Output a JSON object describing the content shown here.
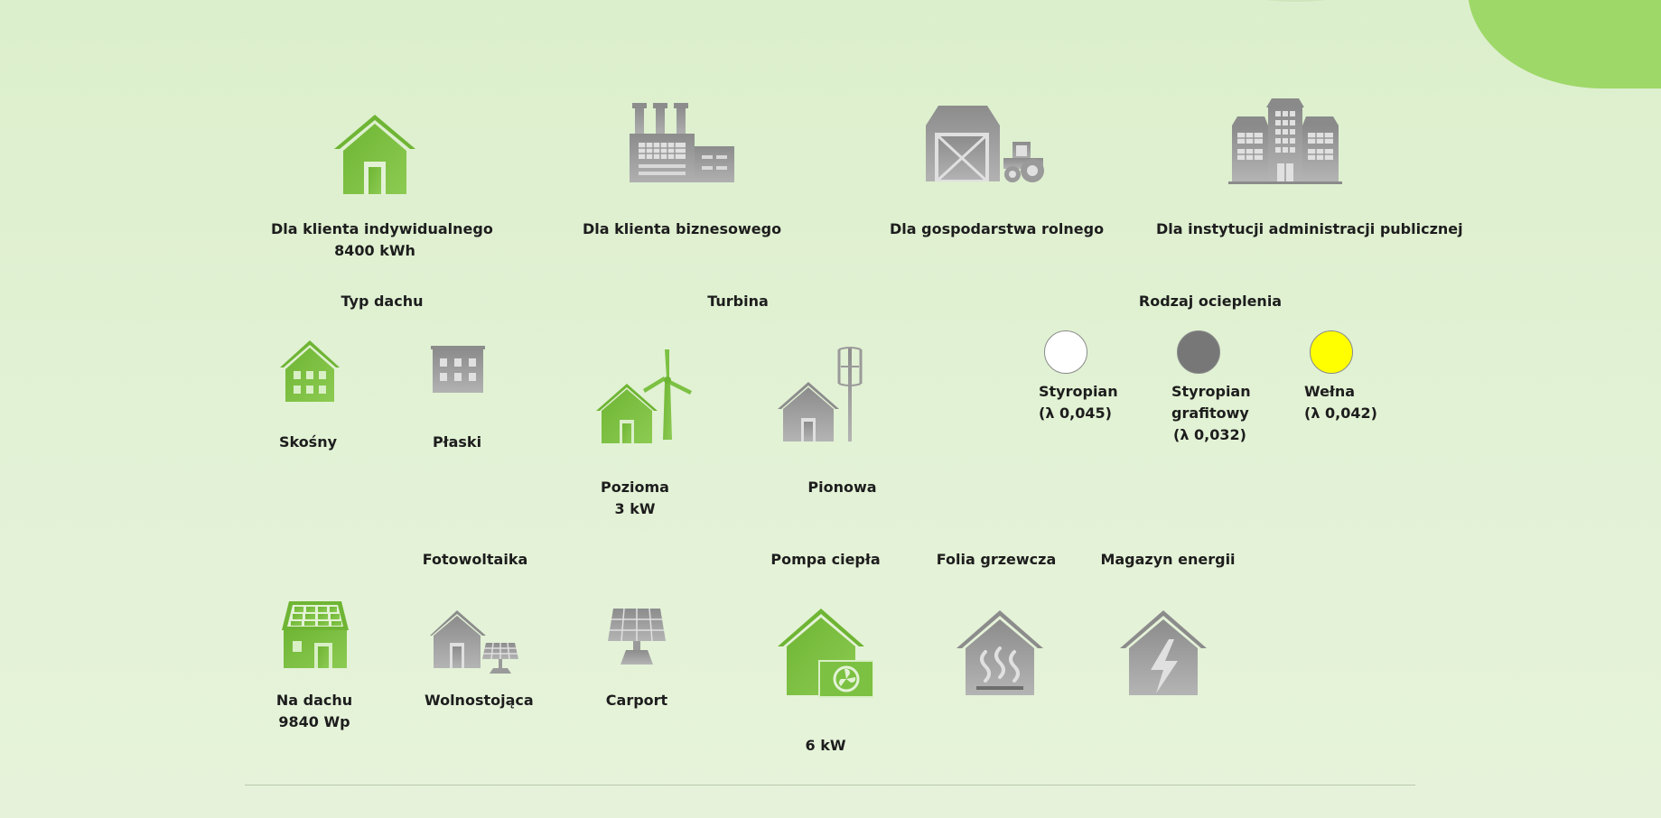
{
  "colors": {
    "active": "#7cc142",
    "inactive": "#9e9e9e"
  },
  "client_types": [
    {
      "label": "Dla klienta indywidualnego",
      "value": "8400 kWh",
      "icon": "house-icon",
      "active": true
    },
    {
      "label": "Dla klienta biznesowego",
      "icon": "factory-icon",
      "active": false
    },
    {
      "label": "Dla gospodarstwa rolnego",
      "icon": "barn-tractor-icon",
      "active": false
    },
    {
      "label": "Dla instytucji administracji publicznej",
      "icon": "public-building-icon",
      "active": false
    }
  ],
  "roof": {
    "title": "Typ dachu",
    "options": [
      {
        "label": "Skośny",
        "icon": "pitched-roof-house-icon",
        "active": true
      },
      {
        "label": "Płaski",
        "icon": "flat-roof-building-icon",
        "active": false
      }
    ]
  },
  "turbine": {
    "title": "Turbina",
    "options": [
      {
        "label": "Pozioma",
        "value": "3 kW",
        "icon": "horizontal-wind-turbine-icon",
        "active": true
      },
      {
        "label": "Pionowa",
        "icon": "vertical-wind-turbine-icon",
        "active": false
      }
    ]
  },
  "insulation": {
    "title": "Rodzaj ocieplenia",
    "options": [
      {
        "line1": "Styropian",
        "line2": "(λ 0,045)",
        "color": "#ffffff"
      },
      {
        "line1": "Styropian",
        "line2": "grafitowy",
        "line3": "(λ 0,032)",
        "color": "#777777"
      },
      {
        "line1": "Wełna",
        "line2": "(λ 0,042)",
        "color": "#ffff00"
      }
    ]
  },
  "photovoltaics": {
    "title": "Fotowoltaika",
    "options": [
      {
        "label": "Na dachu",
        "value": "9840 Wp",
        "icon": "rooftop-solar-icon",
        "active": true
      },
      {
        "label": "Wolnostojąca",
        "icon": "ground-solar-icon",
        "active": false
      },
      {
        "label": "Carport",
        "icon": "carport-solar-icon",
        "active": false
      }
    ]
  },
  "heat_pump": {
    "title": "Pompa ciepła",
    "value": "6 kW",
    "icon": "heat-pump-icon",
    "active": true
  },
  "heating_foil": {
    "title": "Folia grzewcza",
    "icon": "heating-foil-icon",
    "active": false
  },
  "energy_storage": {
    "title": "Magazyn energii",
    "icon": "energy-storage-icon",
    "active": false
  }
}
